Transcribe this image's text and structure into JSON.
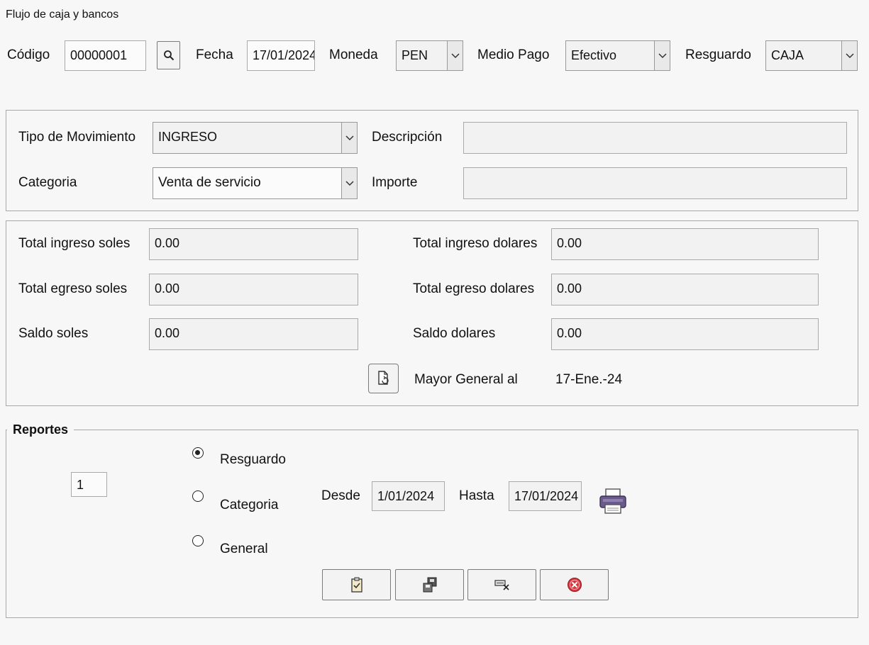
{
  "window": {
    "title": "Flujo de caja y bancos"
  },
  "header": {
    "codigo_label": "Código",
    "codigo_value": "00000001",
    "fecha_label": "Fecha",
    "fecha_value": "17/01/2024",
    "moneda_label": "Moneda",
    "moneda_value": "PEN",
    "medio_pago_label": "Medio Pago",
    "medio_pago_value": "Efectivo",
    "resguardo_label": "Resguardo",
    "resguardo_value": "CAJA"
  },
  "movimiento": {
    "tipo_label": "Tipo de Movimiento",
    "tipo_value": "INGRESO",
    "categoria_label": "Categoria",
    "categoria_value": "Venta de servicio",
    "descripcion_label": "Descripción",
    "descripcion_value": "",
    "importe_label": "Importe",
    "importe_value": ""
  },
  "totales": {
    "ingreso_soles_label": "Total ingreso soles",
    "ingreso_soles_value": "0.00",
    "egreso_soles_label": "Total egreso soles",
    "egreso_soles_value": "0.00",
    "saldo_soles_label": "Saldo soles",
    "saldo_soles_value": "0.00",
    "ingreso_dolares_label": "Total ingreso dolares",
    "ingreso_dolares_value": "0.00",
    "egreso_dolares_label": "Total egreso dolares",
    "egreso_dolares_value": "0.00",
    "saldo_dolares_label": "Saldo dolares",
    "saldo_dolares_value": "0.00",
    "mayor_label": "Mayor General al",
    "mayor_value": "17-Ene.-24"
  },
  "reportes": {
    "legend": "Reportes",
    "number_value": "1",
    "options": [
      "Resguardo",
      "Categoria",
      "General"
    ],
    "selected": "Resguardo",
    "desde_label": "Desde",
    "desde_value": "1/01/2024",
    "hasta_label": "Hasta",
    "hasta_value": "17/01/2024"
  },
  "icons": {
    "search": "search-icon",
    "refresh": "document-refresh-icon",
    "print": "printer-icon",
    "new": "clipboard-check-icon",
    "save": "floppy-disk-icon",
    "clear": "eraser-icon",
    "close": "close-circle-icon"
  },
  "colors": {
    "close_red": "#d9363e",
    "printer_purple": "#6b5a8e"
  }
}
